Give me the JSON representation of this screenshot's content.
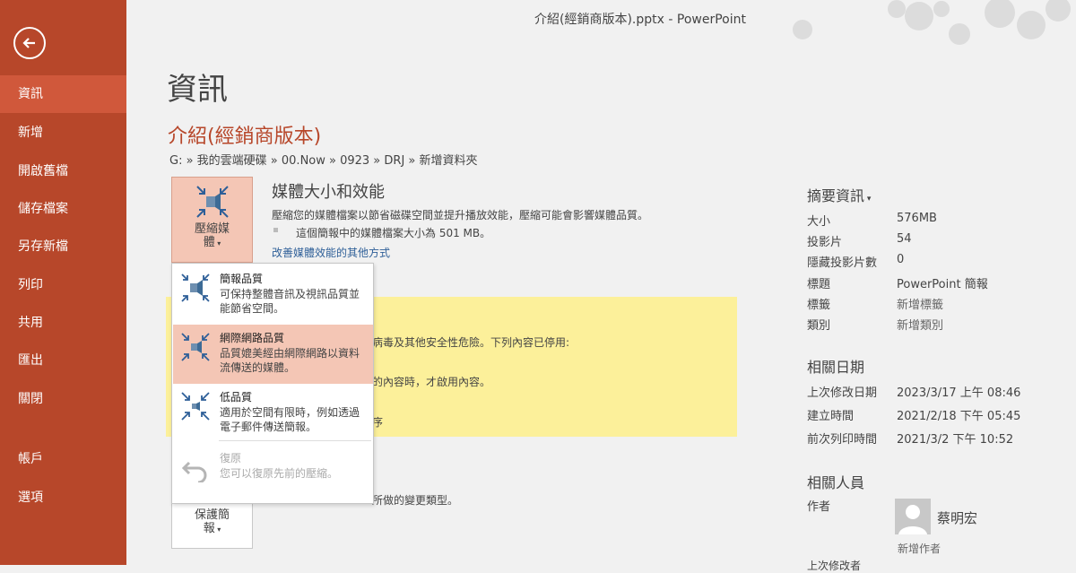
{
  "window": {
    "title": "介紹(經銷商版本).pptx - PowerPoint"
  },
  "sidebar": {
    "items": [
      {
        "label": "資訊",
        "active": true
      },
      {
        "label": "新增"
      },
      {
        "label": "開啟舊檔"
      },
      {
        "label": "儲存檔案"
      },
      {
        "label": "另存新檔"
      },
      {
        "label": "列印"
      },
      {
        "label": "共用"
      },
      {
        "label": "匯出"
      },
      {
        "label": "關閉"
      },
      {
        "label": "帳戶"
      },
      {
        "label": "選項"
      }
    ]
  },
  "main": {
    "heading": "資訊",
    "doc_title": "介紹(經銷商版本)",
    "breadcrumb": "G: » 我的雲端硬碟 » 00.Now » 0923 » DRJ » 新增資料夾",
    "compress_button": {
      "line1": "壓縮媒",
      "line2": "體"
    },
    "media": {
      "title": "媒體大小和效能",
      "description": "壓縮您的媒體檔案以節省磁碟空間並提升播放效能，壓縮可能會影響媒體品質。",
      "size_note": "這個簡報中的媒體檔案大小為 501 MB。",
      "link": "改善媒體效能的其他方式"
    },
    "security_text": "病毒及其他安全性危險。下列內容已停用:",
    "enable_text": "的內容時，才啟用內容。",
    "fragment": "序",
    "protect_button": {
      "line1": "保護簡",
      "line2": "報"
    },
    "change_text": "所做的變更類型。"
  },
  "dropdown": {
    "items": [
      {
        "title": "簡報品質",
        "desc": "可保持整體音訊及視訊品質並能節省空間。"
      },
      {
        "title": "網際網路品質",
        "desc": "品質媲美經由網際網路以資料流傳送的媒體。",
        "highlighted": true
      },
      {
        "title": "低品質",
        "desc": "適用於空間有限時，例如透過電子郵件傳送簡報。"
      },
      {
        "title": "復原",
        "desc": "您可以復原先前的壓縮。",
        "disabled": true
      }
    ]
  },
  "properties": {
    "title": "摘要資訊",
    "rows": [
      {
        "label": "大小",
        "value": "576MB"
      },
      {
        "label": "投影片",
        "value": "54"
      },
      {
        "label": "隱藏投影片數",
        "value": "0"
      },
      {
        "label": "標題",
        "value": "PowerPoint 簡報"
      },
      {
        "label": "標籤",
        "value": "新增標籤"
      },
      {
        "label": "類別",
        "value": "新增類別"
      }
    ]
  },
  "dates": {
    "title": "相關日期",
    "rows": [
      {
        "label": "上次修改日期",
        "value": "2023/3/17 上午 08:46"
      },
      {
        "label": "建立時間",
        "value": "2021/2/18 下午 05:45"
      },
      {
        "label": "前次列印時間",
        "value": "2021/3/2 下午 10:52"
      }
    ]
  },
  "people": {
    "title": "相關人員",
    "author_label": "作者",
    "author_name": "蔡明宏",
    "add_author": "新增作者",
    "last_modified_by": "上次修改者"
  },
  "colors": {
    "accent": "#b7472a",
    "active": "#d0583b",
    "highlight": "#f4c6b5",
    "warning": "#fcf09a"
  }
}
